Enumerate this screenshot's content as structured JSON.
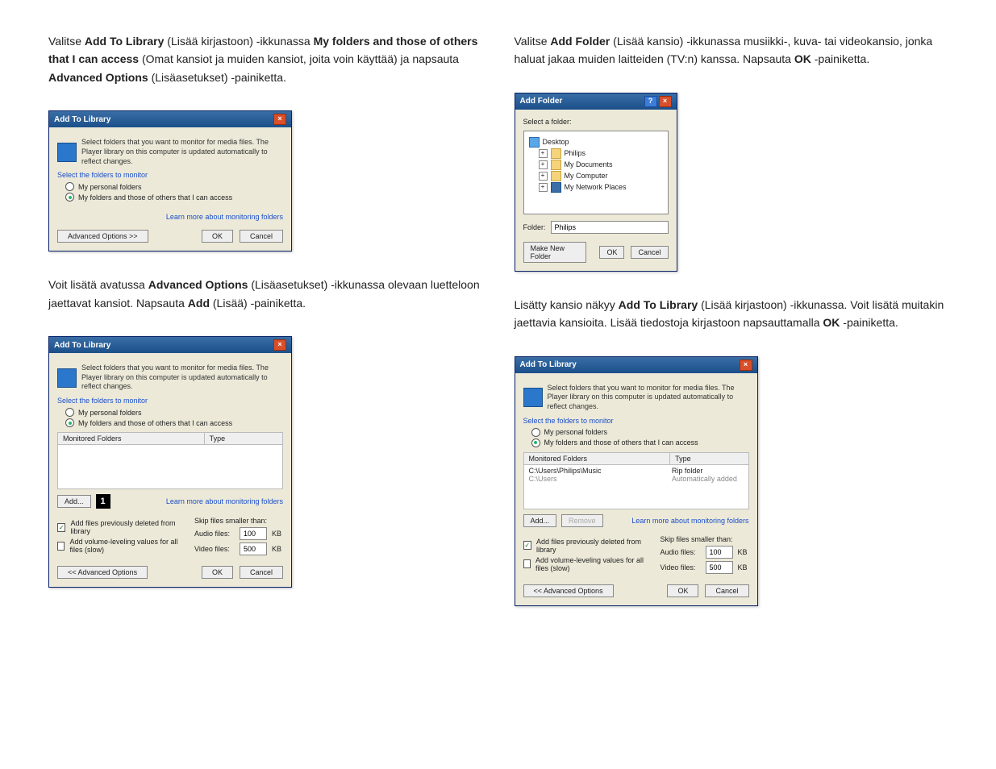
{
  "left": {
    "p1": {
      "t1": "Valitse ",
      "b1": "Add To Library",
      "t2": " (Lisää kirjastoon) -ikkunassa ",
      "b2": "My folders and those of others that I can access",
      "t3": " (Omat kansiot ja muiden kansiot, joita voin käyttää) ja napsauta ",
      "b3": "Advanced Options",
      "t4": " (Lisäasetukset) -painiketta."
    },
    "p2": {
      "t1": "Voit lisätä avatussa ",
      "b1": "Advanced Options",
      "t2": " (Lisäasetukset) -ikkunassa olevaan luetteloon jaettavat kansiot. Napsauta ",
      "b2": "Add",
      "t3": " (Lisää) -painiketta."
    }
  },
  "right": {
    "p1": {
      "t1": "Valitse ",
      "b1": "Add Folder",
      "t2": " (Lisää kansio) -ikkunassa musiikki-, kuva- tai videokansio, jonka haluat jakaa muiden laitteiden (TV:n) kanssa. Napsauta ",
      "b2": "OK",
      "t3": "-painiketta."
    },
    "p2": {
      "t1": "Lisätty kansio näkyy ",
      "b1": "Add To Library",
      "t2": " (Lisää kirjastoon) -ikkunassa. Voit lisätä muitakin jaettavia kansioita. Lisää tiedostoja kirjastoon napsauttamalla ",
      "b2": "OK",
      "t3": "-painiketta."
    }
  },
  "atl": {
    "title": "Add To Library",
    "hint": "Select folders that you want to monitor for media files. The Player library on this computer is updated automatically to reflect changes.",
    "select_folders": "Select the folders to monitor",
    "radio1": "My personal folders",
    "radio2": "My folders and those of others that I can access",
    "learn_more": "Learn more about monitoring folders",
    "adv_btn1": "Advanced Options >>",
    "adv_btn2": "<< Advanced Options",
    "ok": "OK",
    "cancel": "Cancel",
    "monitored_folders": "Monitored Folders",
    "type": "Type",
    "add": "Add...",
    "remove": "Remove",
    "chk_add_prev": "Add files previously deleted from library",
    "chk_volume": "Add volume-leveling values for all files (slow)",
    "skip_smaller": "Skip files smaller than:",
    "audio_files": "Audio files:",
    "video_files": "Video files:",
    "audio_val": "100",
    "video_val": "500",
    "kb": "KB",
    "row_path": "C:\\Users\\Philips\\Music",
    "row_type": "Rip folder",
    "row2_path": "C:\\Users",
    "row2_type": "Automatically added",
    "callout": "1"
  },
  "af": {
    "title": "Add Folder",
    "select": "Select a folder:",
    "desktop": "Desktop",
    "philips": "Philips",
    "mydocs": "My Documents",
    "mycomp": "My Computer",
    "mynet": "My Network Places",
    "folder_lbl": "Folder:",
    "folder_val": "Philips",
    "make_new": "Make New Folder",
    "ok": "OK",
    "cancel": "Cancel"
  }
}
